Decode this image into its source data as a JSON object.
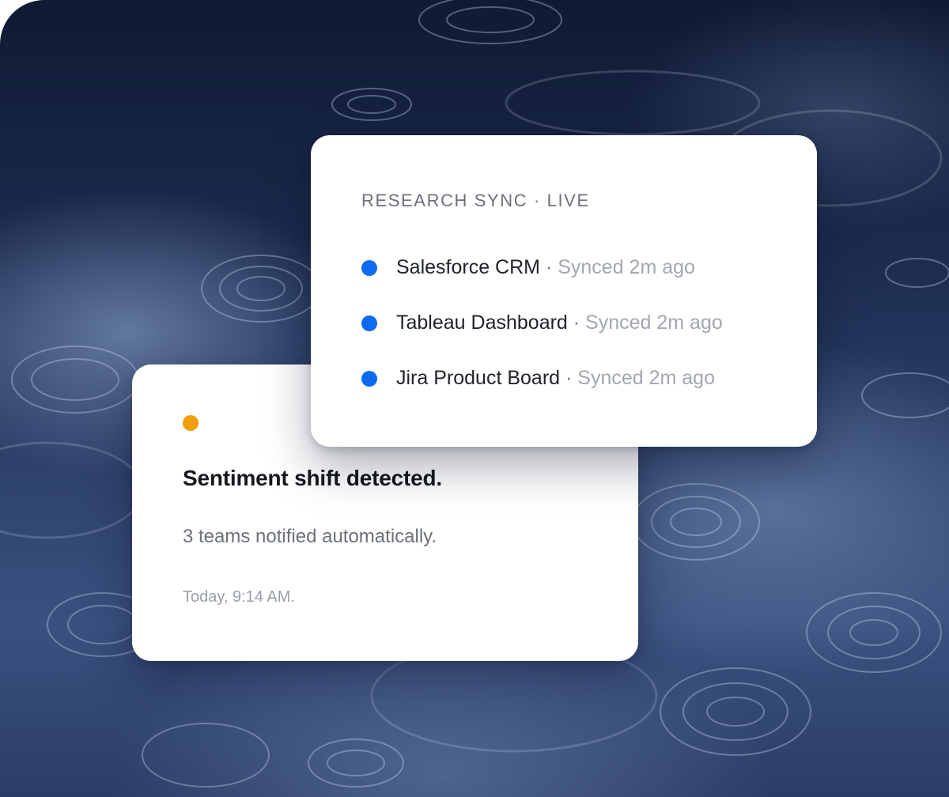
{
  "sync_card": {
    "header": "RESEARCH SYNC · LIVE",
    "separator": " · ",
    "items": [
      {
        "name": "Salesforce CRM",
        "status": "Synced 2m ago"
      },
      {
        "name": "Tableau Dashboard",
        "status": "Synced 2m ago"
      },
      {
        "name": "Jira Product Board",
        "status": "Synced 2m ago"
      }
    ],
    "dot_color": "#0d6bf2"
  },
  "alert_card": {
    "title": "Sentiment shift detected.",
    "body": "3 teams notified automatically.",
    "timestamp": "Today, 9:14 AM.",
    "dot_color": "#f29d0c"
  }
}
